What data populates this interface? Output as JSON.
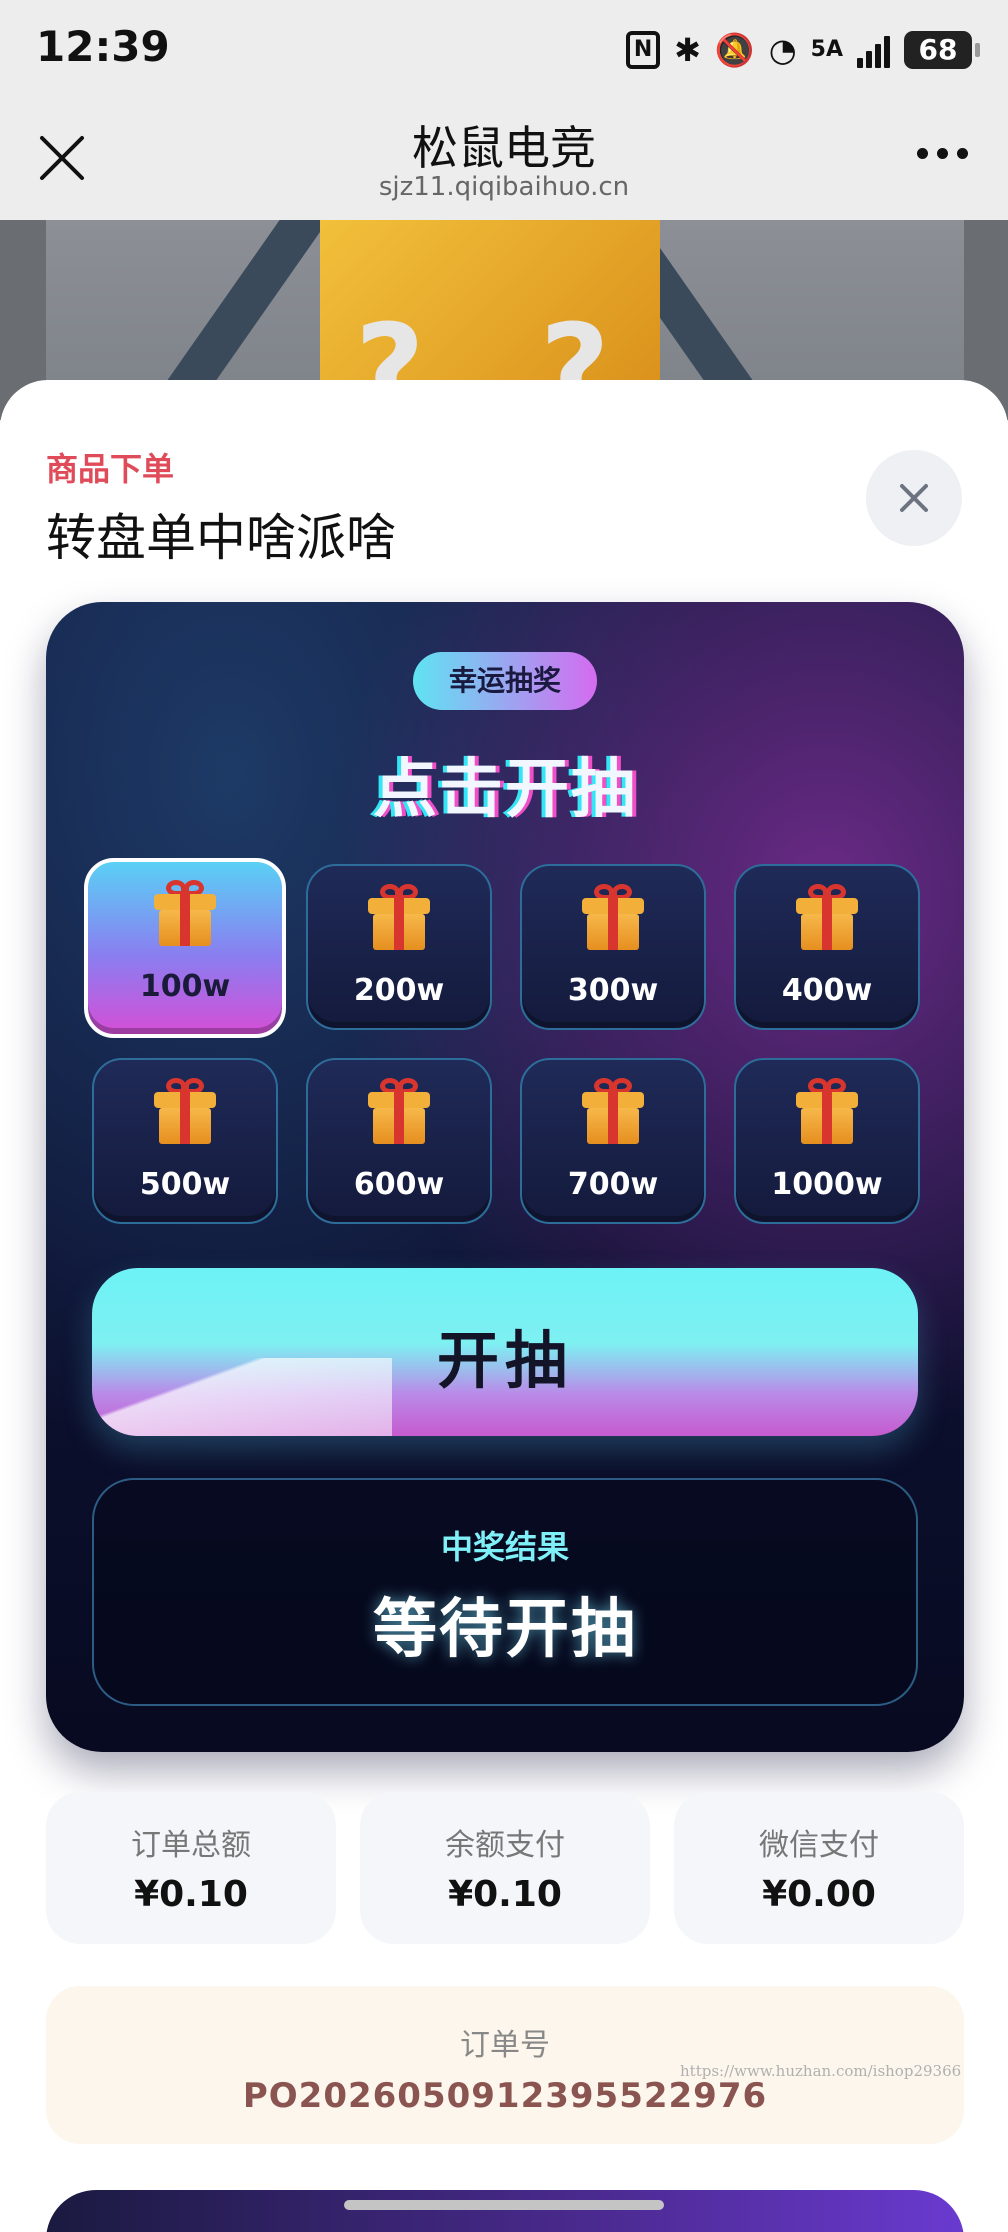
{
  "status": {
    "time": "12:39",
    "network": "5A",
    "battery": "68"
  },
  "nav": {
    "title": "松鼠电竞",
    "url": "sjz11.qiqibaihuo.cn"
  },
  "sheet": {
    "section_label": "商品下单",
    "product_title": "转盘单中啥派啥"
  },
  "game": {
    "pill": "幸运抽奖",
    "title": "点击开抽",
    "prizes": [
      {
        "label": "100w",
        "active": true
      },
      {
        "label": "200w"
      },
      {
        "label": "300w"
      },
      {
        "label": "400w"
      },
      {
        "label": "500w"
      },
      {
        "label": "600w"
      },
      {
        "label": "700w"
      },
      {
        "label": "1000w"
      }
    ],
    "draw_label": "开抽",
    "result_label": "中奖结果",
    "result_value": "等待开抽"
  },
  "summary": [
    {
      "label": "订单总额",
      "value": "¥0.10"
    },
    {
      "label": "余额支付",
      "value": "¥0.10"
    },
    {
      "label": "微信支付",
      "value": "¥0.00"
    }
  ],
  "order": {
    "label": "订单号",
    "value": "PO20260509123955229​76"
  },
  "watermark": "https://www.huzhan.com/ishop29366",
  "icons": {
    "close": "close-icon",
    "more": "more-icon",
    "gift": "gift-icon"
  },
  "colors": {
    "accent_red": "#e04b5a",
    "cyan": "#6df2f6",
    "magenta": "#c65bcf"
  }
}
